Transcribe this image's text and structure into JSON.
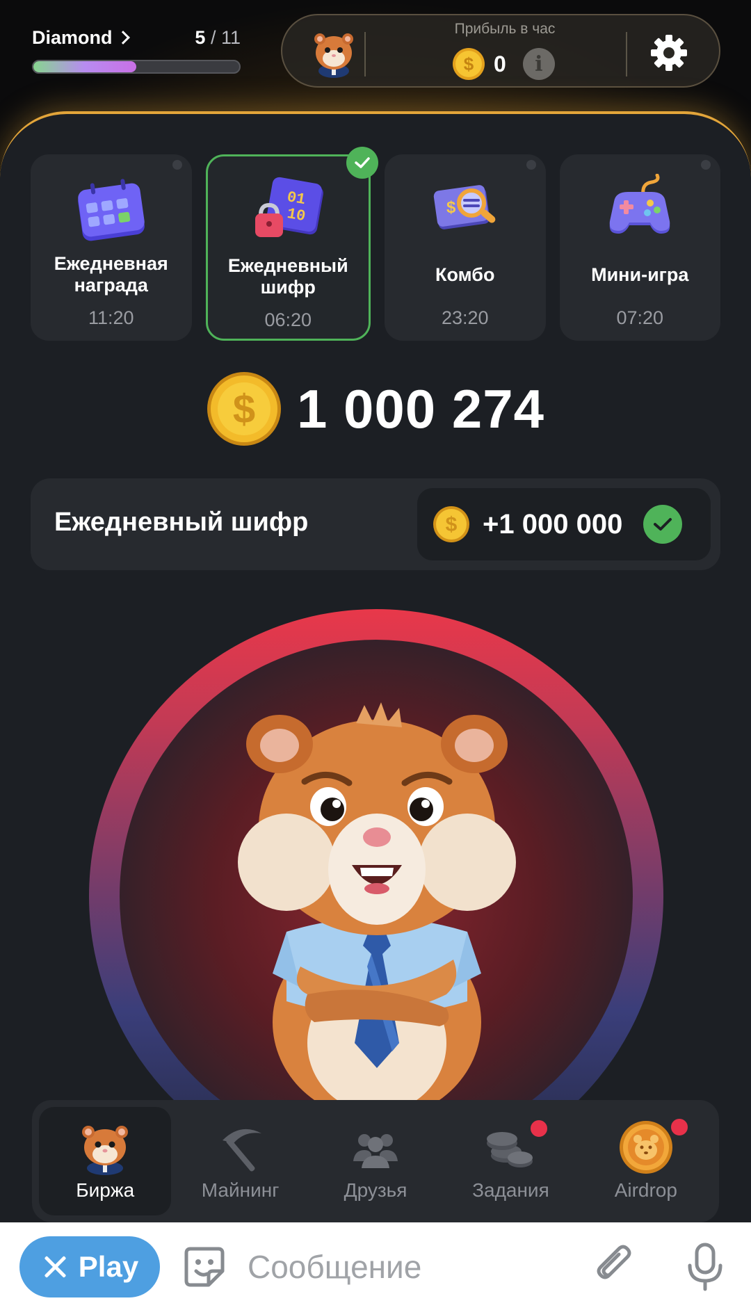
{
  "header": {
    "level_name": "Diamond",
    "level_current": "5",
    "level_total": "/ 11",
    "level_progress": 0.5,
    "profit_label": "Прибыль в час",
    "profit_value": "0"
  },
  "daily": [
    {
      "label": "Ежедневная\nнаграда",
      "time": "11:20",
      "active": false
    },
    {
      "label": "Ежедневный\nшифр",
      "time": "06:20",
      "active": true
    },
    {
      "label": "Комбо",
      "time": "23:20",
      "active": false
    },
    {
      "label": "Мини-игра",
      "time": "07:20",
      "active": false
    }
  ],
  "balance": "1 000 274",
  "cipher": {
    "title": "Ежедневный шифр",
    "reward": "+1 000 000"
  },
  "nav": [
    {
      "label": "Биржа",
      "icon": "hamster-icon",
      "active": true
    },
    {
      "label": "Майнинг",
      "icon": "pickaxe-icon",
      "active": false
    },
    {
      "label": "Друзья",
      "icon": "friends-icon",
      "active": false
    },
    {
      "label": "Задания",
      "icon": "coins-icon",
      "active": false,
      "badge": true
    },
    {
      "label": "Airdrop",
      "icon": "airdrop-coin-icon",
      "active": false,
      "badge": true
    }
  ],
  "telegram": {
    "play_label": "Play",
    "message_placeholder": "Сообщение"
  },
  "colors": {
    "accent_gold": "#e3a53a",
    "success_green": "#4fb359",
    "badge_red": "#e8314a",
    "telegram_blue": "#4e9fe1"
  }
}
